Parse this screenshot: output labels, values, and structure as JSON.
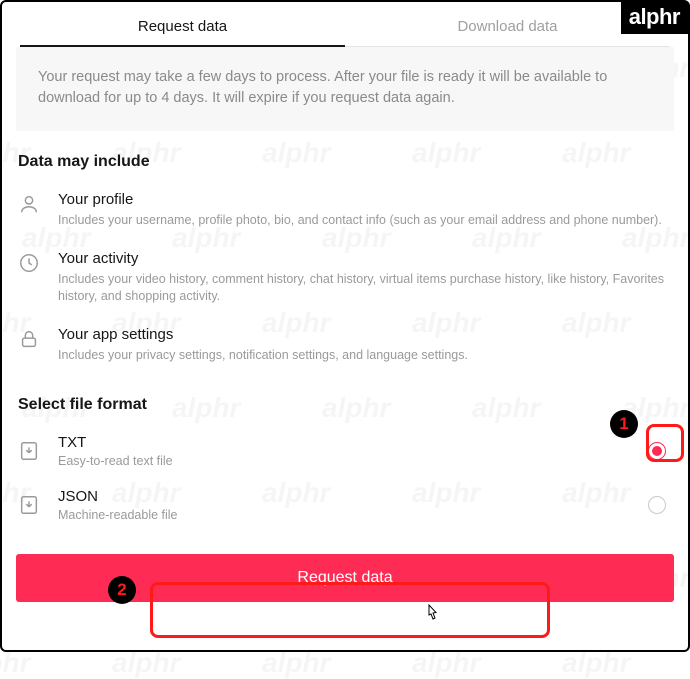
{
  "brand": "alphr",
  "watermark": "alphr",
  "tabs": {
    "request": "Request data",
    "download": "Download data"
  },
  "info_text": "Your request may take a few days to process. After your file is ready it will be available to download for up to 4 days. It will expire if you request data again.",
  "data_section_title": "Data may include",
  "data_items": {
    "profile": {
      "title": "Your profile",
      "desc": "Includes your username, profile photo, bio, and contact info (such as your email address and phone number)."
    },
    "activity": {
      "title": "Your activity",
      "desc": "Includes your video history, comment history, chat history, virtual items purchase history, like history, Favorites history, and shopping activity."
    },
    "settings": {
      "title": "Your app settings",
      "desc": "Includes your privacy settings, notification settings, and language settings."
    }
  },
  "format_section_title": "Select file format",
  "formats": {
    "txt": {
      "title": "TXT",
      "desc": "Easy-to-read text file"
    },
    "json": {
      "title": "JSON",
      "desc": "Machine-readable file"
    }
  },
  "request_button": "Request data",
  "callouts": {
    "one": "1",
    "two": "2"
  },
  "colors": {
    "accent": "#fe2c55",
    "callout": "#ff1a1a"
  }
}
